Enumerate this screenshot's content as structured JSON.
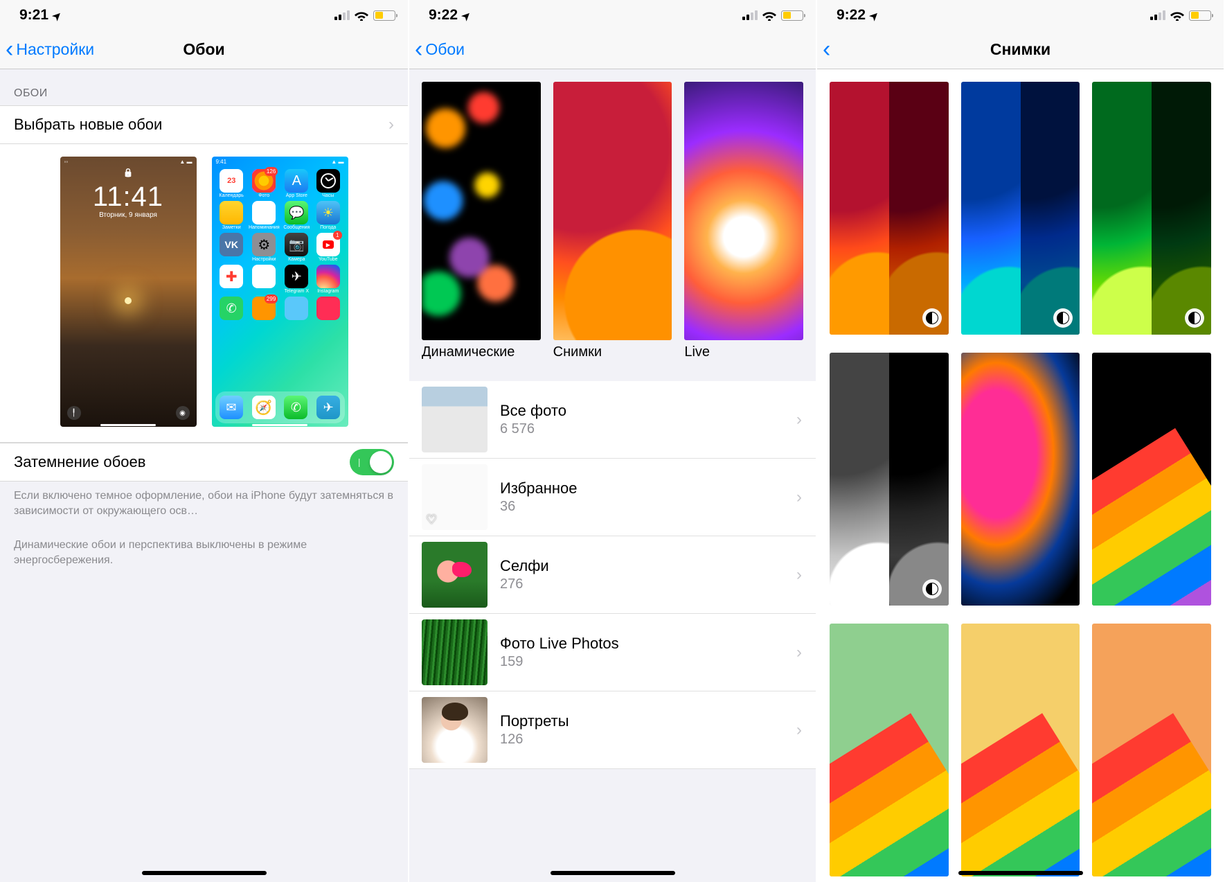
{
  "screen1": {
    "time": "9:21",
    "back": "Настройки",
    "title": "Обои",
    "section_header": "ОБОИ",
    "choose_row": "Выбрать новые обои",
    "lock_preview": {
      "time": "11:41",
      "date": "Вторник, 9 января"
    },
    "dim_row": "Затемнение обоев",
    "dim_on": true,
    "footer1": "Если включено темное оформление, обои на iPhone будут затемняться в зависимости от окружающего осв…",
    "footer2": "Динамические обои и перспектива выключены в режиме энергосбережения."
  },
  "screen2": {
    "time": "9:22",
    "back": "Обои",
    "categories": [
      {
        "label": "Динамические"
      },
      {
        "label": "Снимки"
      },
      {
        "label": "Live"
      }
    ],
    "albums": [
      {
        "title": "Все фото",
        "count": "6 576"
      },
      {
        "title": "Избранное",
        "count": "36"
      },
      {
        "title": "Селфи",
        "count": "276"
      },
      {
        "title": "Фото Live Photos",
        "count": "159"
      },
      {
        "title": "Портреты",
        "count": "126"
      }
    ]
  },
  "screen3": {
    "time": "9:22",
    "title": "Снимки"
  }
}
